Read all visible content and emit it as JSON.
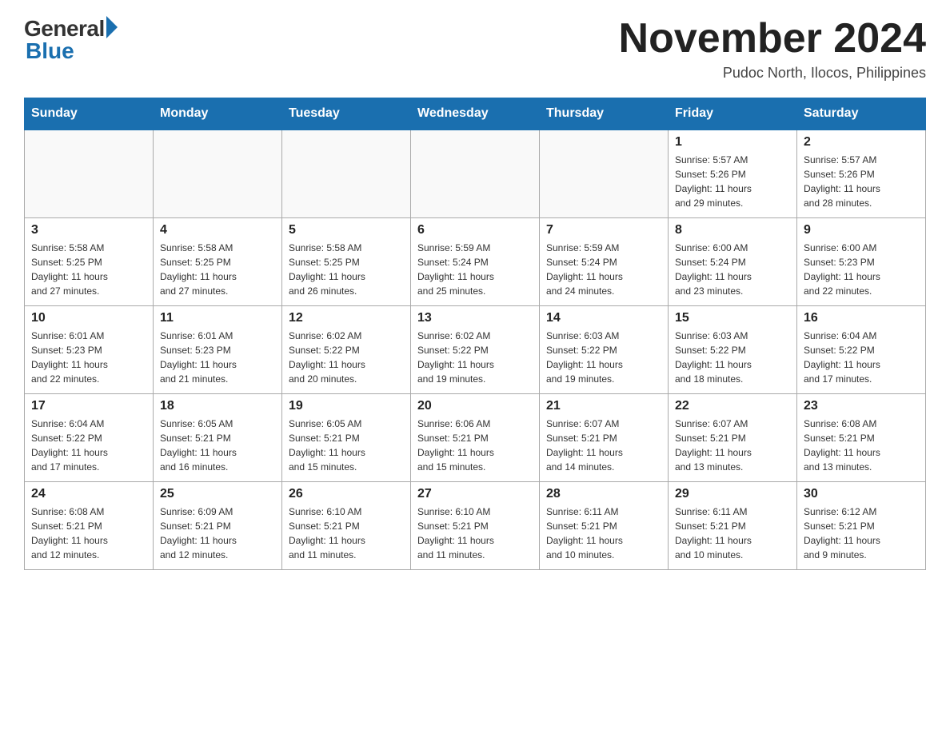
{
  "header": {
    "logo_general": "General",
    "logo_blue": "Blue",
    "month_year": "November 2024",
    "location": "Pudoc North, Ilocos, Philippines"
  },
  "days_of_week": [
    "Sunday",
    "Monday",
    "Tuesday",
    "Wednesday",
    "Thursday",
    "Friday",
    "Saturday"
  ],
  "weeks": [
    [
      {
        "day": "",
        "info": ""
      },
      {
        "day": "",
        "info": ""
      },
      {
        "day": "",
        "info": ""
      },
      {
        "day": "",
        "info": ""
      },
      {
        "day": "",
        "info": ""
      },
      {
        "day": "1",
        "info": "Sunrise: 5:57 AM\nSunset: 5:26 PM\nDaylight: 11 hours\nand 29 minutes."
      },
      {
        "day": "2",
        "info": "Sunrise: 5:57 AM\nSunset: 5:26 PM\nDaylight: 11 hours\nand 28 minutes."
      }
    ],
    [
      {
        "day": "3",
        "info": "Sunrise: 5:58 AM\nSunset: 5:25 PM\nDaylight: 11 hours\nand 27 minutes."
      },
      {
        "day": "4",
        "info": "Sunrise: 5:58 AM\nSunset: 5:25 PM\nDaylight: 11 hours\nand 27 minutes."
      },
      {
        "day": "5",
        "info": "Sunrise: 5:58 AM\nSunset: 5:25 PM\nDaylight: 11 hours\nand 26 minutes."
      },
      {
        "day": "6",
        "info": "Sunrise: 5:59 AM\nSunset: 5:24 PM\nDaylight: 11 hours\nand 25 minutes."
      },
      {
        "day": "7",
        "info": "Sunrise: 5:59 AM\nSunset: 5:24 PM\nDaylight: 11 hours\nand 24 minutes."
      },
      {
        "day": "8",
        "info": "Sunrise: 6:00 AM\nSunset: 5:24 PM\nDaylight: 11 hours\nand 23 minutes."
      },
      {
        "day": "9",
        "info": "Sunrise: 6:00 AM\nSunset: 5:23 PM\nDaylight: 11 hours\nand 22 minutes."
      }
    ],
    [
      {
        "day": "10",
        "info": "Sunrise: 6:01 AM\nSunset: 5:23 PM\nDaylight: 11 hours\nand 22 minutes."
      },
      {
        "day": "11",
        "info": "Sunrise: 6:01 AM\nSunset: 5:23 PM\nDaylight: 11 hours\nand 21 minutes."
      },
      {
        "day": "12",
        "info": "Sunrise: 6:02 AM\nSunset: 5:22 PM\nDaylight: 11 hours\nand 20 minutes."
      },
      {
        "day": "13",
        "info": "Sunrise: 6:02 AM\nSunset: 5:22 PM\nDaylight: 11 hours\nand 19 minutes."
      },
      {
        "day": "14",
        "info": "Sunrise: 6:03 AM\nSunset: 5:22 PM\nDaylight: 11 hours\nand 19 minutes."
      },
      {
        "day": "15",
        "info": "Sunrise: 6:03 AM\nSunset: 5:22 PM\nDaylight: 11 hours\nand 18 minutes."
      },
      {
        "day": "16",
        "info": "Sunrise: 6:04 AM\nSunset: 5:22 PM\nDaylight: 11 hours\nand 17 minutes."
      }
    ],
    [
      {
        "day": "17",
        "info": "Sunrise: 6:04 AM\nSunset: 5:22 PM\nDaylight: 11 hours\nand 17 minutes."
      },
      {
        "day": "18",
        "info": "Sunrise: 6:05 AM\nSunset: 5:21 PM\nDaylight: 11 hours\nand 16 minutes."
      },
      {
        "day": "19",
        "info": "Sunrise: 6:05 AM\nSunset: 5:21 PM\nDaylight: 11 hours\nand 15 minutes."
      },
      {
        "day": "20",
        "info": "Sunrise: 6:06 AM\nSunset: 5:21 PM\nDaylight: 11 hours\nand 15 minutes."
      },
      {
        "day": "21",
        "info": "Sunrise: 6:07 AM\nSunset: 5:21 PM\nDaylight: 11 hours\nand 14 minutes."
      },
      {
        "day": "22",
        "info": "Sunrise: 6:07 AM\nSunset: 5:21 PM\nDaylight: 11 hours\nand 13 minutes."
      },
      {
        "day": "23",
        "info": "Sunrise: 6:08 AM\nSunset: 5:21 PM\nDaylight: 11 hours\nand 13 minutes."
      }
    ],
    [
      {
        "day": "24",
        "info": "Sunrise: 6:08 AM\nSunset: 5:21 PM\nDaylight: 11 hours\nand 12 minutes."
      },
      {
        "day": "25",
        "info": "Sunrise: 6:09 AM\nSunset: 5:21 PM\nDaylight: 11 hours\nand 12 minutes."
      },
      {
        "day": "26",
        "info": "Sunrise: 6:10 AM\nSunset: 5:21 PM\nDaylight: 11 hours\nand 11 minutes."
      },
      {
        "day": "27",
        "info": "Sunrise: 6:10 AM\nSunset: 5:21 PM\nDaylight: 11 hours\nand 11 minutes."
      },
      {
        "day": "28",
        "info": "Sunrise: 6:11 AM\nSunset: 5:21 PM\nDaylight: 11 hours\nand 10 minutes."
      },
      {
        "day": "29",
        "info": "Sunrise: 6:11 AM\nSunset: 5:21 PM\nDaylight: 11 hours\nand 10 minutes."
      },
      {
        "day": "30",
        "info": "Sunrise: 6:12 AM\nSunset: 5:21 PM\nDaylight: 11 hours\nand 9 minutes."
      }
    ]
  ]
}
